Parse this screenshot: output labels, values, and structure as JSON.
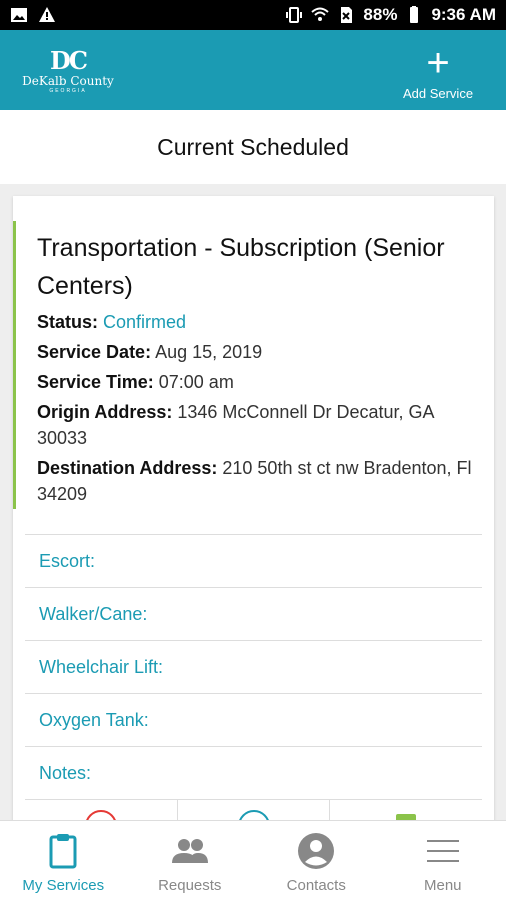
{
  "status_bar": {
    "battery": "88%",
    "time": "9:36 AM"
  },
  "header": {
    "logo_mark": "DC",
    "logo_name": "DeKalb County",
    "logo_sub": "GEORGIA",
    "add_service_label": "Add Service"
  },
  "page_title": "Current Scheduled",
  "service": {
    "title": "Transportation - Subscription (Senior Centers)",
    "status_label": "Status:",
    "status_value": "Confirmed",
    "date_label": "Service Date:",
    "date_value": "Aug 15, 2019",
    "time_label": "Service Time:",
    "time_value": "07:00 am",
    "origin_label": "Origin Address:",
    "origin_value": "1346 McConnell Dr Decatur, GA 30033",
    "dest_label": "Destination Address:",
    "dest_value": "210 50th st ct nw Bradenton, Fl 34209",
    "options": [
      "Escort:",
      "Walker/Cane:",
      "Wheelchair Lift:",
      "Oxygen Tank:",
      "Notes:"
    ]
  },
  "nav": {
    "items": [
      {
        "label": "My Services",
        "icon": "clipboard-icon",
        "active": true
      },
      {
        "label": "Requests",
        "icon": "people-icon",
        "active": false
      },
      {
        "label": "Contacts",
        "icon": "person-circle-icon",
        "active": false
      },
      {
        "label": "Menu",
        "icon": "hamburger-icon",
        "active": false
      }
    ]
  },
  "colors": {
    "brand": "#1b9bb3",
    "accent": "#8bc34a",
    "cancel": "#e53935"
  }
}
